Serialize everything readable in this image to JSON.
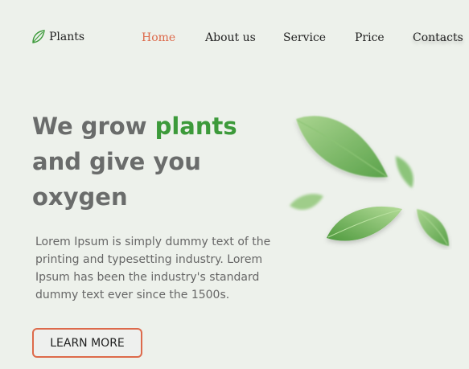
{
  "brand": {
    "name": "Plants",
    "icon": "leaf-outline-icon"
  },
  "nav": {
    "items": [
      {
        "label": "Home",
        "active": true
      },
      {
        "label": "About us",
        "active": false
      },
      {
        "label": "Service",
        "active": false
      },
      {
        "label": "Price",
        "active": false
      },
      {
        "label": "Contacts",
        "active": false
      }
    ]
  },
  "hero": {
    "headline": {
      "part1": "We grow ",
      "highlight": "plants",
      "line2": "and give you",
      "line3": "oxygen"
    },
    "description_lines": [
      "Lorem Ipsum is simply dummy text of the",
      "printing and typesetting industry. Lorem",
      "Ipsum has been the industry's standard",
      "dummy text ever since the 1500s."
    ],
    "cta_label": "LEARN MORE",
    "illustration": "falling-leaves-image"
  },
  "colors": {
    "background": "#edf1eb",
    "accent_orange": "#dd6a4b",
    "accent_green": "#3c9a3a",
    "headline_gray": "#6a6c6b"
  }
}
